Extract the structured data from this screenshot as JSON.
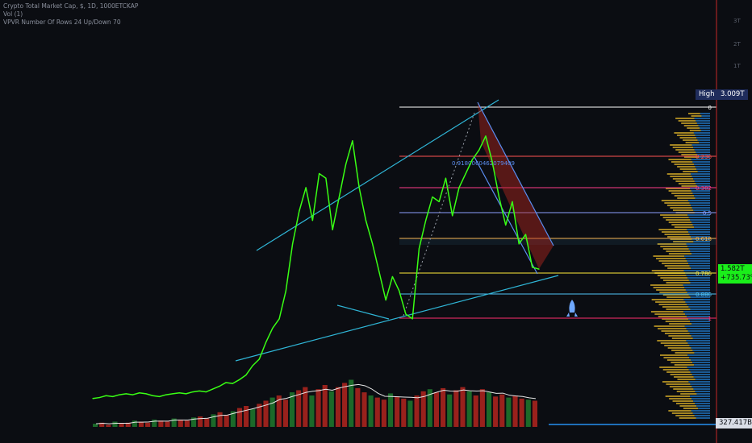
{
  "header": {
    "line1": "Crypto Total Market Cap, $, 1D, 1000ETCKAP",
    "line2": "Vol (1)",
    "line3": "VPVR Number Of Rows 24 Up/Down 70"
  },
  "colors": {
    "background": "#0b0d12",
    "price_line": "#39ff14",
    "channel": "#2fb5d6",
    "volume_up": "#1f7a2e",
    "volume_down": "#b3261e",
    "volume_ma": "#e6e6e6",
    "fib_0": "#ffffff",
    "fib_236": "#ff5252",
    "fib_382": "#ff3d8b",
    "fib_5": "#8c9eff",
    "fib_618": "#ffb74d",
    "fib_786": "#ffeb3b",
    "fib_886": "#4fc3f7",
    "fib_1": "#ff2d6f",
    "profile_up": "#c9a227",
    "profile_down": "#1f6fb8",
    "last_price_bg": "#1aee1a",
    "crosshair": "#c62828"
  },
  "y_axis": {
    "ticks": [
      "3T",
      "2T",
      "1T"
    ]
  },
  "labels": {
    "high_title": "High",
    "high_value": "3.009T",
    "last_value": "1.582T",
    "last_change": "+735.73%",
    "low_value": "327.417B",
    "ratio_text": "0.9180060462079409"
  },
  "fib_levels": [
    {
      "label": "0",
      "color": "#ffffff"
    },
    {
      "label": "0.236",
      "color": "#ff5252"
    },
    {
      "label": "0.382",
      "color": "#ff3d8b"
    },
    {
      "label": "0.5",
      "color": "#8c9eff"
    },
    {
      "label": "0.618",
      "color": "#ffb74d"
    },
    {
      "label": "0.786",
      "color": "#ffeb3b"
    },
    {
      "label": "0.886",
      "color": "#4fc3f7"
    },
    {
      "label": "1",
      "color": "#ff2d6f"
    }
  ],
  "chart_data": {
    "type": "line",
    "title": "Crypto Total Market Cap, $, 1D",
    "ylabel": "",
    "ylim": [
      0,
      3.3
    ],
    "grid": false,
    "series": [
      {
        "name": "Total Market Cap",
        "x": [
          0,
          10,
          20,
          30,
          40,
          50,
          60,
          70,
          80,
          90,
          100,
          110,
          120,
          130,
          140,
          150,
          160,
          170,
          180,
          190,
          200,
          210,
          220,
          230,
          240,
          250,
          260,
          270,
          280,
          290,
          300,
          310,
          320,
          330,
          340,
          350,
          360,
          370,
          380,
          390,
          400,
          410,
          420,
          430,
          440,
          450,
          460,
          470,
          480,
          490,
          500,
          510,
          520,
          530,
          540,
          550,
          560,
          570,
          580,
          590,
          600,
          610,
          620,
          630,
          640,
          650,
          660,
          670
        ],
        "values": [
          0.2,
          0.21,
          0.23,
          0.22,
          0.24,
          0.25,
          0.24,
          0.26,
          0.25,
          0.23,
          0.22,
          0.24,
          0.25,
          0.26,
          0.25,
          0.27,
          0.28,
          0.27,
          0.3,
          0.33,
          0.37,
          0.36,
          0.4,
          0.45,
          0.55,
          0.62,
          0.8,
          0.95,
          1.05,
          1.35,
          1.85,
          2.2,
          2.45,
          2.1,
          2.6,
          2.55,
          2.0,
          2.35,
          2.7,
          2.95,
          2.45,
          2.1,
          1.85,
          1.55,
          1.25,
          1.5,
          1.35,
          1.1,
          1.05,
          1.8,
          2.1,
          2.35,
          2.3,
          2.55,
          2.15,
          2.45,
          2.6,
          2.75,
          2.85,
          3.0,
          2.72,
          2.35,
          2.05,
          2.3,
          1.85,
          1.95,
          1.6,
          1.58
        ]
      }
    ],
    "fib_values": [
      {
        "level": 0,
        "value": 3.009
      },
      {
        "level": 0.236,
        "value": 2.6
      },
      {
        "level": 0.382,
        "value": 2.28
      },
      {
        "level": 0.5,
        "value": 2.0
      },
      {
        "level": 0.618,
        "value": 1.7
      },
      {
        "level": 0.786,
        "value": 1.57
      },
      {
        "level": 0.886,
        "value": 1.28
      },
      {
        "level": 1,
        "value": 1.0
      }
    ],
    "volume": [
      3,
      4,
      2,
      5,
      3,
      4,
      6,
      5,
      4,
      7,
      6,
      5,
      8,
      7,
      6,
      9,
      10,
      8,
      12,
      14,
      11,
      15,
      18,
      20,
      17,
      22,
      25,
      28,
      30,
      26,
      33,
      35,
      38,
      30,
      36,
      40,
      34,
      38,
      42,
      45,
      37,
      33,
      30,
      28,
      26,
      32,
      29,
      27,
      25,
      30,
      34,
      36,
      33,
      37,
      31,
      35,
      38,
      34,
      30,
      36,
      33,
      29,
      31,
      28,
      30,
      27,
      26,
      25
    ]
  }
}
